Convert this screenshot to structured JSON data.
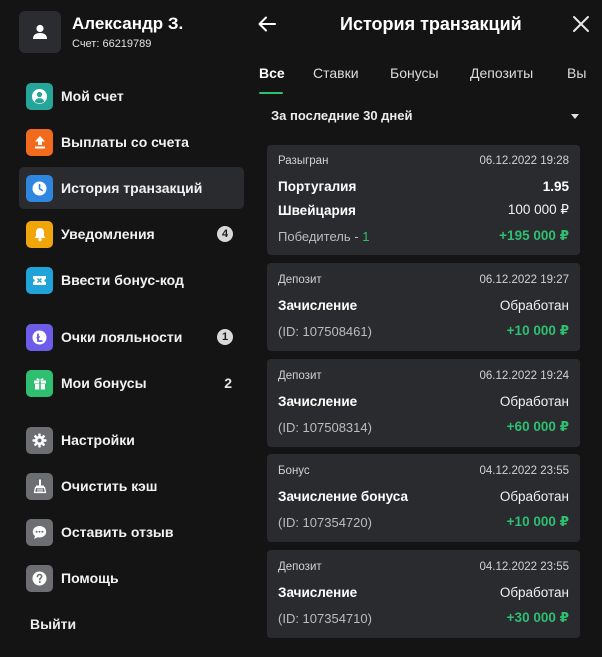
{
  "user": {
    "name": "Александр З.",
    "account": "Счет: 66219789"
  },
  "sidebar": {
    "items": [
      {
        "label": "Мой счет",
        "icon": "user-circle-icon",
        "color": "#26a69a"
      },
      {
        "label": "Выплаты со счета",
        "icon": "upload-icon",
        "color": "#f26a1b"
      },
      {
        "label": "История транзакций",
        "icon": "clock-icon",
        "color": "#2e86de",
        "active": true
      },
      {
        "label": "Уведомления",
        "icon": "bell-icon",
        "color": "#f0a60a",
        "badge": "4"
      },
      {
        "label": "Ввести бонус-код",
        "icon": "ticket-icon",
        "color": "#1fa3d9"
      },
      {
        "label": "Очки лояльности",
        "icon": "loyalty-icon",
        "color": "#6c5ce7",
        "badge": "1"
      },
      {
        "label": "Мои бонусы",
        "icon": "gift-icon",
        "color": "#2fbf71",
        "count": "2"
      },
      {
        "label": "Настройки",
        "icon": "gear-icon",
        "color": "#6d6e72"
      },
      {
        "label": "Очистить кэш",
        "icon": "broom-icon",
        "color": "#6d6e72"
      },
      {
        "label": "Оставить отзыв",
        "icon": "chat-icon",
        "color": "#6d6e72"
      },
      {
        "label": "Помощь",
        "icon": "help-icon",
        "color": "#6d6e72"
      }
    ],
    "logout": "Выйти"
  },
  "header": {
    "title": "История транзакций",
    "back_icon": "arrow-left-icon",
    "close_icon": "close-icon"
  },
  "tabs": [
    "Все",
    "Ставки",
    "Бонусы",
    "Депозиты",
    "Вы"
  ],
  "filter": {
    "label": "За последние 30 дней"
  },
  "transactions": [
    {
      "type": "Разыгран",
      "date": "06.12.2022 19:28",
      "lines": [
        {
          "left": "Португалия",
          "right": "1.95"
        },
        {
          "left": "Швейцария",
          "right": "100 000 ₽"
        }
      ],
      "winner_label": "Победитель - ",
      "winner_value": "1",
      "amount": "+195 000 ₽"
    },
    {
      "type": "Депозит",
      "date": "06.12.2022 19:27",
      "title": "Зачисление",
      "status": "Обработан",
      "id": "(ID: 107508461)",
      "amount": "+10 000 ₽"
    },
    {
      "type": "Депозит",
      "date": "06.12.2022 19:24",
      "title": "Зачисление",
      "status": "Обработан",
      "id": "(ID: 107508314)",
      "amount": "+60 000 ₽"
    },
    {
      "type": "Бонус",
      "date": "04.12.2022 23:55",
      "title": "Зачисление бонуса",
      "status": "Обработан",
      "id": "(ID: 107354720)",
      "amount": "+10 000 ₽"
    },
    {
      "type": "Депозит",
      "date": "04.12.2022 23:55",
      "title": "Зачисление",
      "status": "Обработан",
      "id": "(ID: 107354710)",
      "amount": "+30 000 ₽"
    }
  ],
  "colors": {
    "accent_green": "#2fbf71",
    "card_bg": "#2a2b2f",
    "page_bg": "#141414"
  }
}
